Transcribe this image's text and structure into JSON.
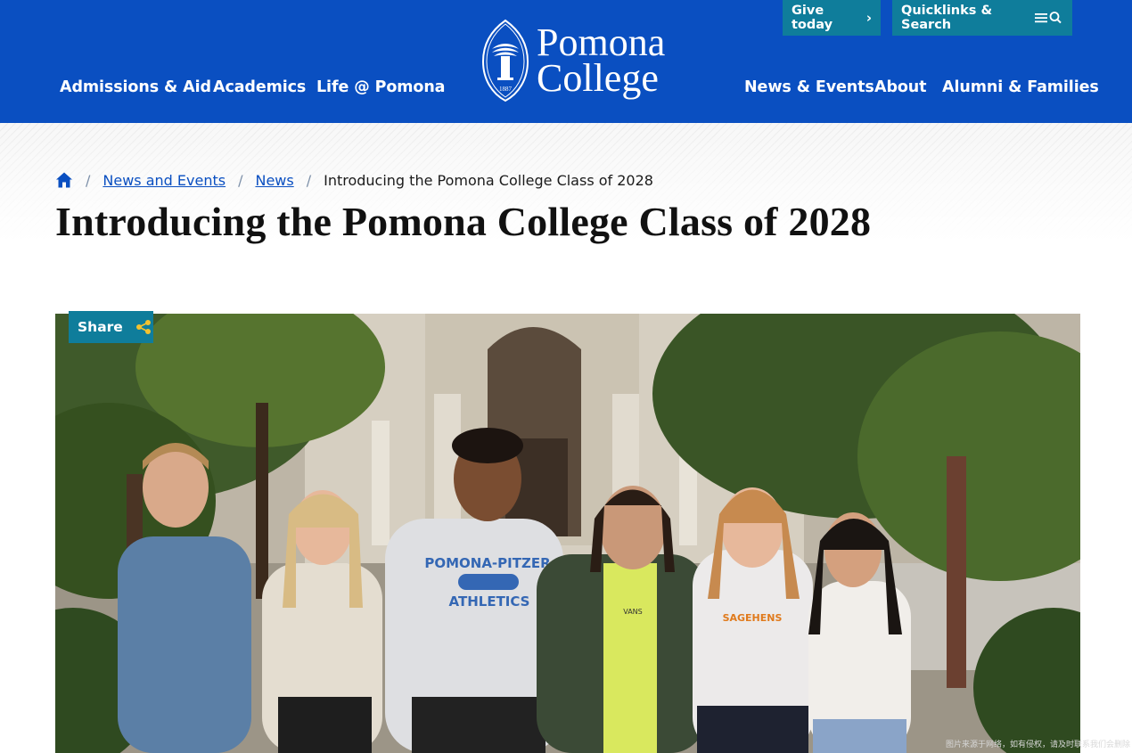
{
  "header": {
    "give_today": "Give today",
    "quicklinks": "Quicklinks & Search",
    "logo_line1": "Pomona",
    "logo_line2": "College",
    "seal_year": "1887",
    "nav_left": [
      "Admissions & Aid",
      "Academics",
      "Life @ Pomona"
    ],
    "nav_right": [
      "News & Events",
      "About",
      "Alumni & Families"
    ]
  },
  "breadcrumb": {
    "items": [
      "News and Events",
      "News"
    ],
    "current": "Introducing the Pomona College Class of 2028"
  },
  "page_title": "Introducing the Pomona College Class of 2028",
  "share_label": "Share",
  "hero": {
    "shirt_text_1": "POMONA-PITZER",
    "shirt_text_2": "ATHLETICS",
    "shirt_text_3": "VANS",
    "shirt_text_4": "SAGEHENS"
  },
  "watermark": "图片来源于网络，如有侵权，请及时联系我们会删除",
  "colors": {
    "header_blue": "#0a4fc1",
    "teal": "#0f7d9b",
    "link": "#0a4fc1"
  }
}
